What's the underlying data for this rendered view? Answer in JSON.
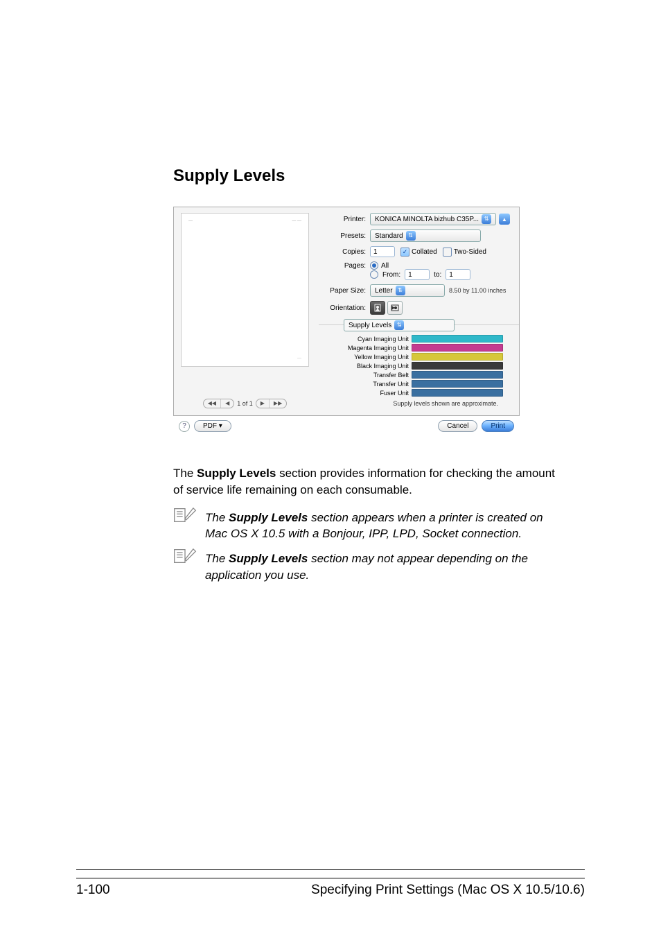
{
  "heading": "Supply Levels",
  "dialog": {
    "printer_label": "Printer:",
    "printer_value": "KONICA MINOLTA bizhub C35P...",
    "presets_label": "Presets:",
    "presets_value": "Standard",
    "copies_label": "Copies:",
    "copies_value": "1",
    "collated_label": "Collated",
    "twosided_label": "Two-Sided",
    "pages_label": "Pages:",
    "pages_all": "All",
    "pages_from": "From:",
    "pages_from_value": "1",
    "pages_to": "to:",
    "pages_to_value": "1",
    "papersize_label": "Paper Size:",
    "papersize_value": "Letter",
    "papersize_note": "8.50 by 11.00 inches",
    "orientation_label": "Orientation:",
    "section_value": "Supply Levels",
    "supplies": [
      {
        "name": "Cyan Imaging Unit",
        "color": "#2fb8c9"
      },
      {
        "name": "Magenta Imaging Unit",
        "color": "#c43b90"
      },
      {
        "name": "Yellow Imaging Unit",
        "color": "#d6c73a"
      },
      {
        "name": "Black Imaging Unit",
        "color": "#3a3a3a"
      },
      {
        "name": "Transfer Belt",
        "color": "#3a6fa0"
      },
      {
        "name": "Transfer Unit",
        "color": "#3a6fa0"
      },
      {
        "name": "Fuser Unit",
        "color": "#3a6fa0"
      }
    ],
    "supplies_footnote": "Supply levels shown are approximate.",
    "preview_counter": "1 of 1",
    "pdf_button": "PDF ▾",
    "cancel": "Cancel",
    "print": "Print"
  },
  "paragraph": {
    "p1_pre": "The ",
    "p1_bold": "Supply Levels",
    "p1_post": " section provides information for checking the amount of service life remaining on each consumable."
  },
  "notes": {
    "n1_pre": "The ",
    "n1_bold": "Supply Levels",
    "n1_post": " section appears when a printer is created on Mac OS X 10.5 with a Bonjour, IPP, LPD, Socket connection.",
    "n2_pre": "The ",
    "n2_bold": "Supply Levels",
    "n2_post": " section may not appear depending on the application you use."
  },
  "footer": {
    "page_no": "1-100",
    "title": "Specifying Print Settings (Mac OS X 10.5/10.6)"
  }
}
